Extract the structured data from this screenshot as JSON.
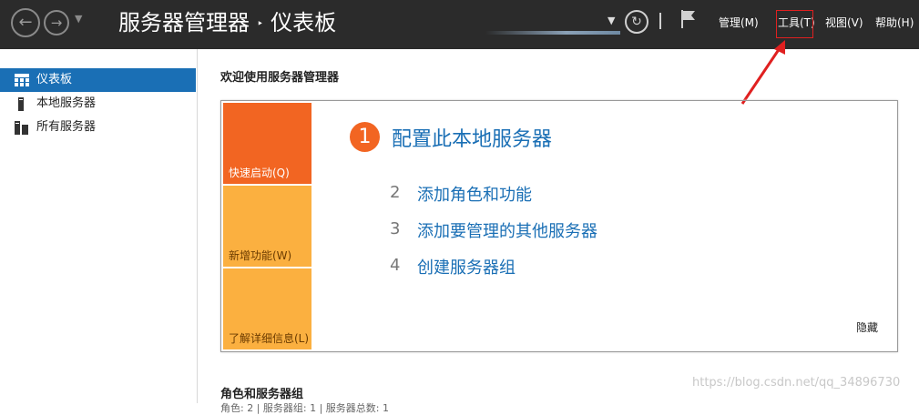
{
  "header": {
    "title": "服务器管理器",
    "separator": "‣",
    "page": "仪表板",
    "menus": [
      "管理(M)",
      "工具(T)",
      "视图(V)",
      "帮助(H)"
    ]
  },
  "sidebar": {
    "items": [
      {
        "label": "仪表板",
        "icon": "dashboard-icon"
      },
      {
        "label": "本地服务器",
        "icon": "server-icon"
      },
      {
        "label": "所有服务器",
        "icon": "servers-icon"
      }
    ]
  },
  "main": {
    "welcome": "欢迎使用服务器管理器",
    "tiles": [
      "快速启动(Q)",
      "新增功能(W)",
      "了解详细信息(L)"
    ],
    "step1": {
      "num": "1",
      "label": "配置此本地服务器"
    },
    "steps": [
      {
        "num": "2",
        "label": "添加角色和功能"
      },
      {
        "num": "3",
        "label": "添加要管理的其他服务器"
      },
      {
        "num": "4",
        "label": "创建服务器组"
      }
    ],
    "hide": "隐藏",
    "roles_title": "角色和服务器组",
    "roles_sub": "角色: 2 | 服务器组: 1 | 服务器总数: 1"
  },
  "watermark": "https://blog.csdn.net/qq_34896730",
  "colors": {
    "accent": "#1a6fb5",
    "tile_orange": "#f26522",
    "tile_yellow": "#fbb040",
    "annotation": "#e02020"
  }
}
